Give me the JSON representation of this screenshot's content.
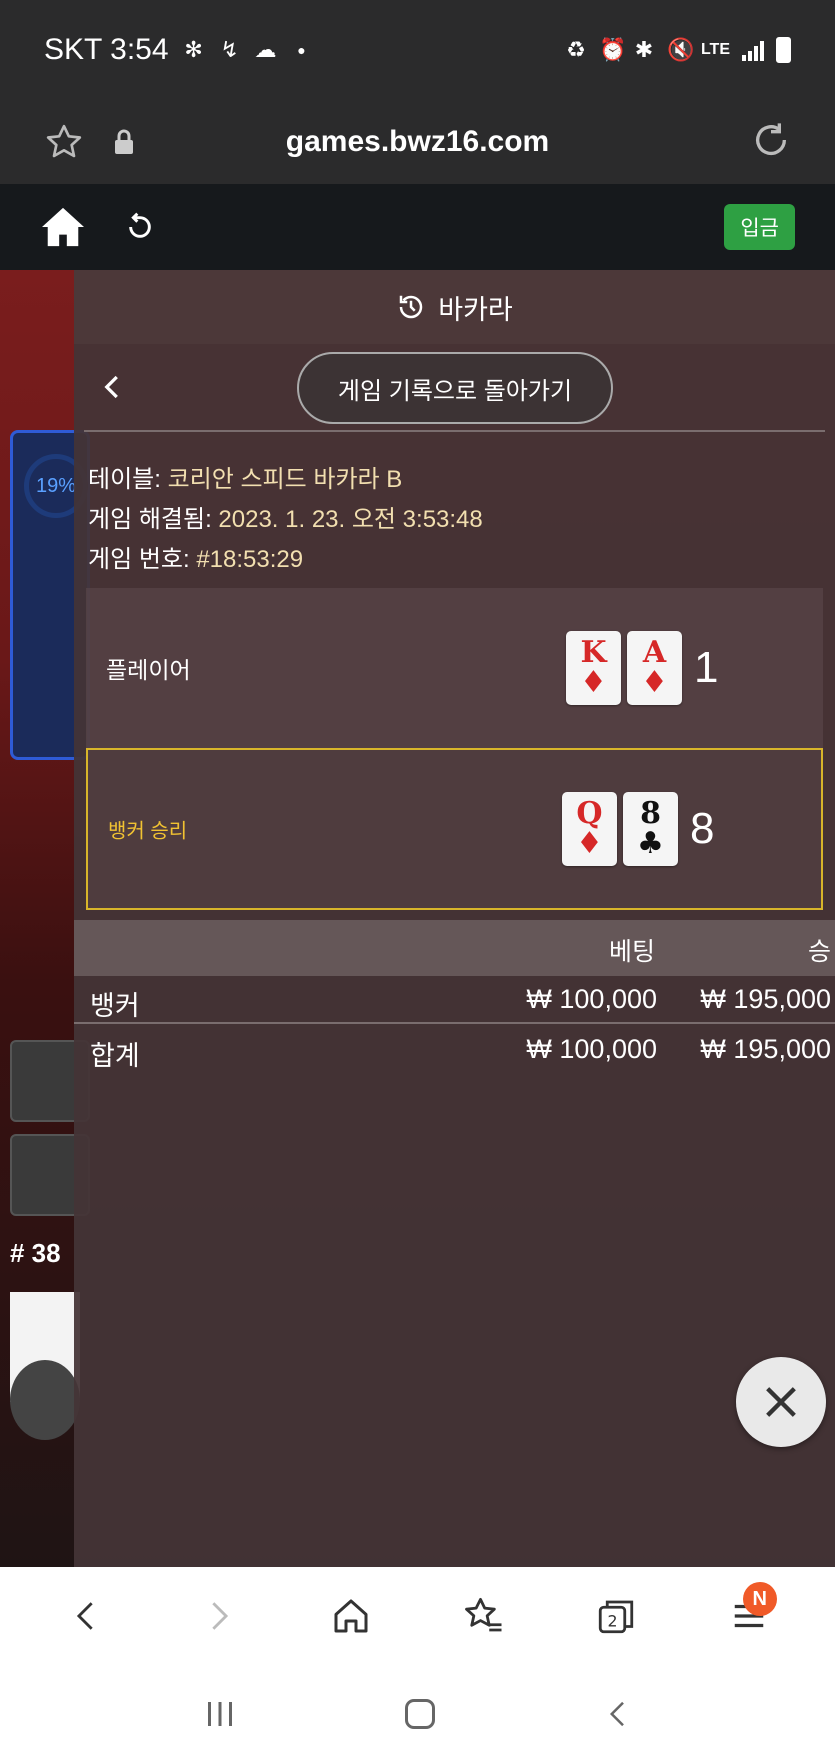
{
  "status_bar": {
    "carrier_time": "SKT 3:54",
    "network": "LTE",
    "icons": [
      "fan-icon",
      "missed-call-icon",
      "cloud-icon",
      "dot-icon",
      "battery-saver-icon",
      "alarm-icon",
      "bluetooth-icon",
      "mute-icon",
      "lte-icon",
      "signal-icon",
      "battery-icon"
    ]
  },
  "browser": {
    "url": "games.bwz16.com"
  },
  "game_toolbar": {
    "deposit_label": "입금"
  },
  "background": {
    "percent": "19%",
    "round_number": "# 38"
  },
  "modal": {
    "title": "바카라",
    "return_label": "게임 기록으로 돌아가기",
    "info": {
      "table_label": "테이블: ",
      "table_value": "코리안 스피드 바카라 B",
      "resolved_label": "게임 해결됨: ",
      "resolved_value": "2023. 1. 23. 오전 3:53:48",
      "game_no_label": "게임 번호: ",
      "game_no_value": "#18:53:29"
    },
    "player": {
      "label": "플레이어",
      "cards": [
        {
          "rank": "K",
          "suit": "♦",
          "color": "red"
        },
        {
          "rank": "A",
          "suit": "♦",
          "color": "red"
        }
      ],
      "score": "1"
    },
    "banker": {
      "label": "뱅커 승리",
      "cards": [
        {
          "rank": "Q",
          "suit": "♦",
          "color": "red"
        },
        {
          "rank": "8",
          "suit": "♣",
          "color": "black"
        }
      ],
      "score": "8",
      "highlight_color": "#d8b52a"
    },
    "bets": {
      "col_bet": "베팅",
      "col_win": "승",
      "rows": [
        {
          "name": "뱅커",
          "bet": "₩ 100,000",
          "win": "₩ 195,000"
        },
        {
          "name": "합계",
          "bet": "₩ 100,000",
          "win": "₩ 195,000"
        }
      ]
    }
  }
}
